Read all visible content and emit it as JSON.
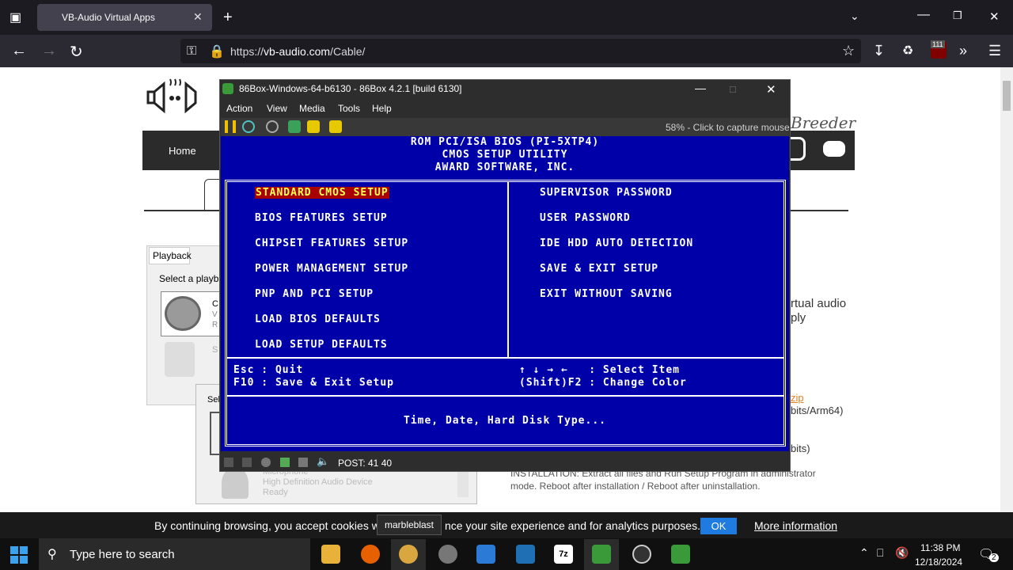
{
  "browser": {
    "tab_title": "VB-Audio Virtual Apps",
    "url_prefix": "https://",
    "url_host": "vb-audio.com",
    "url_path": "/Cable/",
    "extension_badge": "111"
  },
  "website": {
    "nav_home": "Home",
    "brand_right": "Breeder",
    "text_line1": "rtual audio",
    "text_line2": "ply",
    "zip_link": "zip",
    "bits_arm64": "bits/Arm64)",
    "bits2": "bits)",
    "install_line1": "INSTALLATION: Extract all files and Run Setup Program in administrator",
    "install_line2": "mode. Reboot after installation / Reboot after uninstallation.",
    "cookie_text": "By continuing browsing, you accept cookies w",
    "cookie_text2": "nce your site experience and for analytics purposes.",
    "ok_label": "OK",
    "more_info": "More information"
  },
  "sound_dialog": {
    "tab": "Playback",
    "prompt": "Select a playba",
    "device1_line1": "C",
    "device1_line2": "V",
    "device1_line3": "R",
    "device2_line1": "S",
    "sel_label": "Sel",
    "mic_name": "Microphone",
    "mic_device": "High Definition Audio Device",
    "mic_status": "Ready"
  },
  "tooltip": "marbleblast",
  "emulator": {
    "title": "86Box-Windows-64-b6130 - 86Box 4.2.1 [build 6130]",
    "menu": [
      "Action",
      "View",
      "Media",
      "Tools",
      "Help"
    ],
    "capture_hint": "58% - Click to capture mouse",
    "post": "POST: 41 40"
  },
  "bios": {
    "header1": "ROM PCI/ISA BIOS (PI-5XTP4)",
    "header2": "CMOS SETUP UTILITY",
    "header3": "AWARD SOFTWARE, INC.",
    "left_items": [
      "STANDARD CMOS SETUP",
      "BIOS FEATURES SETUP",
      "CHIPSET FEATURES SETUP",
      "POWER MANAGEMENT SETUP",
      "PNP AND PCI SETUP",
      "LOAD BIOS DEFAULTS",
      "LOAD SETUP DEFAULTS"
    ],
    "right_items": [
      "SUPERVISOR PASSWORD",
      "USER PASSWORD",
      "IDE HDD AUTO DETECTION",
      "SAVE & EXIT SETUP",
      "EXIT WITHOUT SAVING"
    ],
    "help_left1": "Esc : Quit",
    "help_left2": "F10 : Save & Exit Setup",
    "help_right1": "↑ ↓ → ←   : Select Item",
    "help_right2": "(Shift)F2 : Change Color",
    "description": "Time, Date, Hard Disk Type..."
  },
  "taskbar": {
    "search_placeholder": "Type here to search",
    "time": "11:38 PM",
    "date": "12/18/2024",
    "notification_count": "2"
  }
}
